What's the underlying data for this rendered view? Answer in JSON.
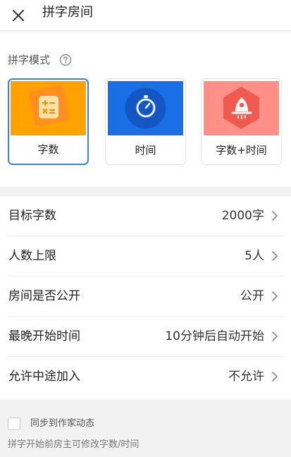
{
  "header": {
    "title": "拼字房间",
    "close_icon": "close-icon"
  },
  "mode": {
    "label": "拼字模式",
    "help_icon": "question-circle-icon",
    "options": [
      {
        "label": "字数",
        "icon": "calculator-icon",
        "color": "#ff9f00",
        "selected": true
      },
      {
        "label": "时间",
        "icon": "stopwatch-icon",
        "color": "#1e72e8",
        "selected": false
      },
      {
        "label": "字数+时间",
        "icon": "rocket-icon",
        "color": "#ff8c86",
        "selected": false
      }
    ]
  },
  "settings": {
    "rows": [
      {
        "label": "目标字数",
        "value": "2000字"
      },
      {
        "label": "人数上限",
        "value": "5人"
      },
      {
        "label": "房间是否公开",
        "value": "公开"
      },
      {
        "label": "最晚开始时间",
        "value": "10分钟后自动开始"
      },
      {
        "label": "允许中途加入",
        "value": "不允许"
      }
    ]
  },
  "footer": {
    "sync_label": "同步到作家动态",
    "sync_checked": false,
    "note": "拼字开始前房主可修改字数/时间"
  },
  "colors": {
    "accent": "#3a84d6",
    "page_bg": "#f2f2f2"
  }
}
